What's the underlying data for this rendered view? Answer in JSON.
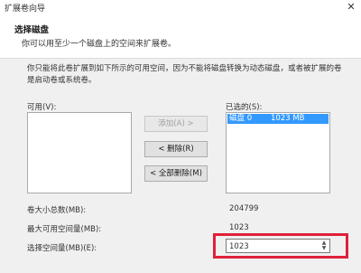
{
  "window": {
    "title": "扩展卷向导",
    "close_glyph": "✕"
  },
  "header": {
    "title": "选择磁盘",
    "subtitle": "你可以用至少一个磁盘上的空间来扩展卷。"
  },
  "description": "你只能将此卷扩展到如下所示的可用空间，因为不能将磁盘转换为动态磁盘，或者被扩展的卷是启动卷或系统卷。",
  "available": {
    "label": "可用(V):",
    "items": []
  },
  "selected": {
    "label": "已选的(S):",
    "items": [
      {
        "disk": "磁盘 0",
        "size": "1023 MB"
      }
    ]
  },
  "buttons": {
    "add": "添加(A) >",
    "remove": "< 删除(R)",
    "remove_all": "< 全部删除(M)"
  },
  "fields": {
    "total_size_label": "卷大小总数(MB):",
    "total_size_value": "204799",
    "max_space_label": "最大可用空间量(MB):",
    "max_space_value": "1023",
    "select_space_label": "选择空间量(MB)(E):",
    "select_space_value": "1023"
  },
  "colors": {
    "highlight_border": "#e0203a",
    "selection": "#3399ff"
  }
}
